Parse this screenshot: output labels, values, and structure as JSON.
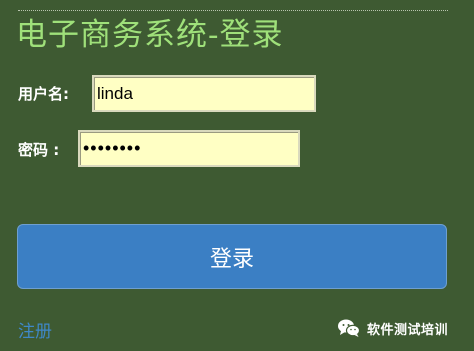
{
  "page": {
    "title": "电子商务系统-登录"
  },
  "form": {
    "username_label": "用户名:",
    "username_value": "linda",
    "password_label": "密码 :",
    "password_value": "12345678",
    "login_button_label": "登录",
    "register_link_label": "注册"
  },
  "watermark": {
    "icon": "wechat-icon",
    "text": "软件测试培训"
  },
  "colors": {
    "background": "#3e5a32",
    "title": "#9fe07a",
    "input_background": "#ffffc4",
    "button": "#3b7fc4",
    "link": "#3f88c8"
  }
}
